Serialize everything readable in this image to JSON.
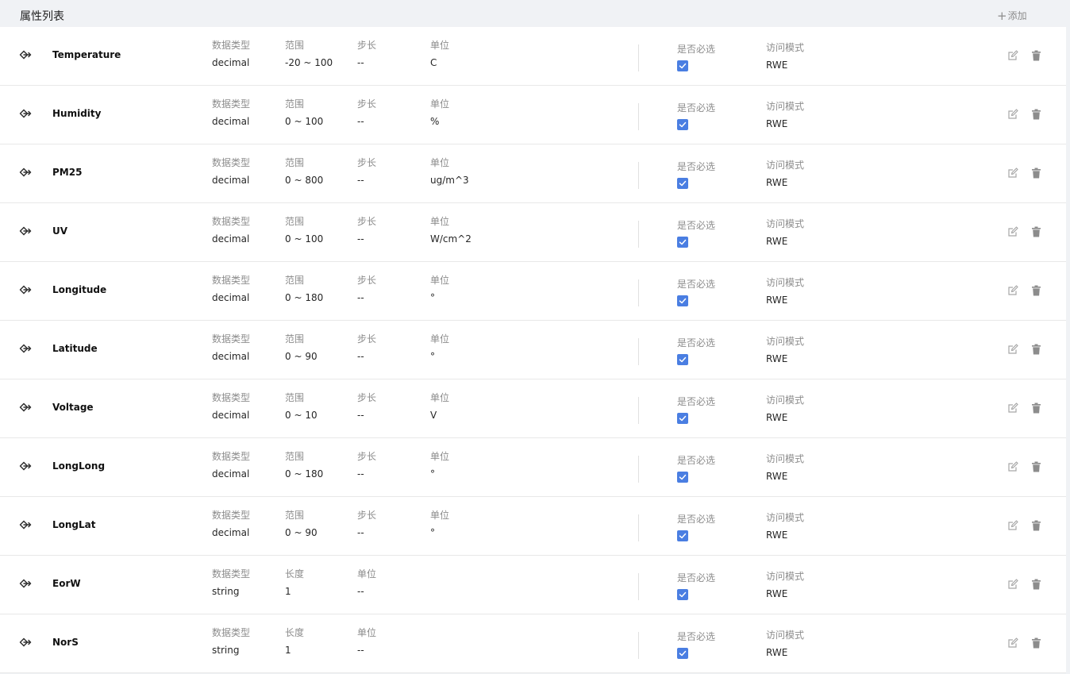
{
  "header": {
    "title": "属性列表",
    "add_label": "添加"
  },
  "labels": {
    "data_type": "数据类型",
    "range": "范围",
    "step": "步长",
    "unit": "单位",
    "length": "长度",
    "required": "是否必选",
    "access_mode": "访问模式"
  },
  "colors": {
    "checkbox": "#4a7ee2"
  },
  "properties": [
    {
      "name": "Temperature",
      "type": "decimal",
      "range": "-20 ~ 100",
      "step": "--",
      "unit": "C",
      "required": true,
      "access": "RWE"
    },
    {
      "name": "Humidity",
      "type": "decimal",
      "range": "0 ~ 100",
      "step": "--",
      "unit": "%",
      "required": true,
      "access": "RWE"
    },
    {
      "name": "PM25",
      "type": "decimal",
      "range": "0 ~ 800",
      "step": "--",
      "unit": "ug/m^3",
      "required": true,
      "access": "RWE"
    },
    {
      "name": "UV",
      "type": "decimal",
      "range": "0 ~ 100",
      "step": "--",
      "unit": "W/cm^2",
      "required": true,
      "access": "RWE"
    },
    {
      "name": "Longitude",
      "type": "decimal",
      "range": "0 ~ 180",
      "step": "--",
      "unit": "°",
      "required": true,
      "access": "RWE"
    },
    {
      "name": "Latitude",
      "type": "decimal",
      "range": "0 ~ 90",
      "step": "--",
      "unit": "°",
      "required": true,
      "access": "RWE"
    },
    {
      "name": "Voltage",
      "type": "decimal",
      "range": "0 ~ 10",
      "step": "--",
      "unit": "V",
      "required": true,
      "access": "RWE"
    },
    {
      "name": "LongLong",
      "type": "decimal",
      "range": "0 ~ 180",
      "step": "--",
      "unit": "°",
      "required": true,
      "access": "RWE"
    },
    {
      "name": "LongLat",
      "type": "decimal",
      "range": "0 ~ 90",
      "step": "--",
      "unit": "°",
      "required": true,
      "access": "RWE"
    },
    {
      "name": "EorW",
      "type": "string",
      "length": "1",
      "unit": "--",
      "required": true,
      "access": "RWE"
    },
    {
      "name": "NorS",
      "type": "string",
      "length": "1",
      "unit": "--",
      "required": true,
      "access": "RWE"
    }
  ]
}
